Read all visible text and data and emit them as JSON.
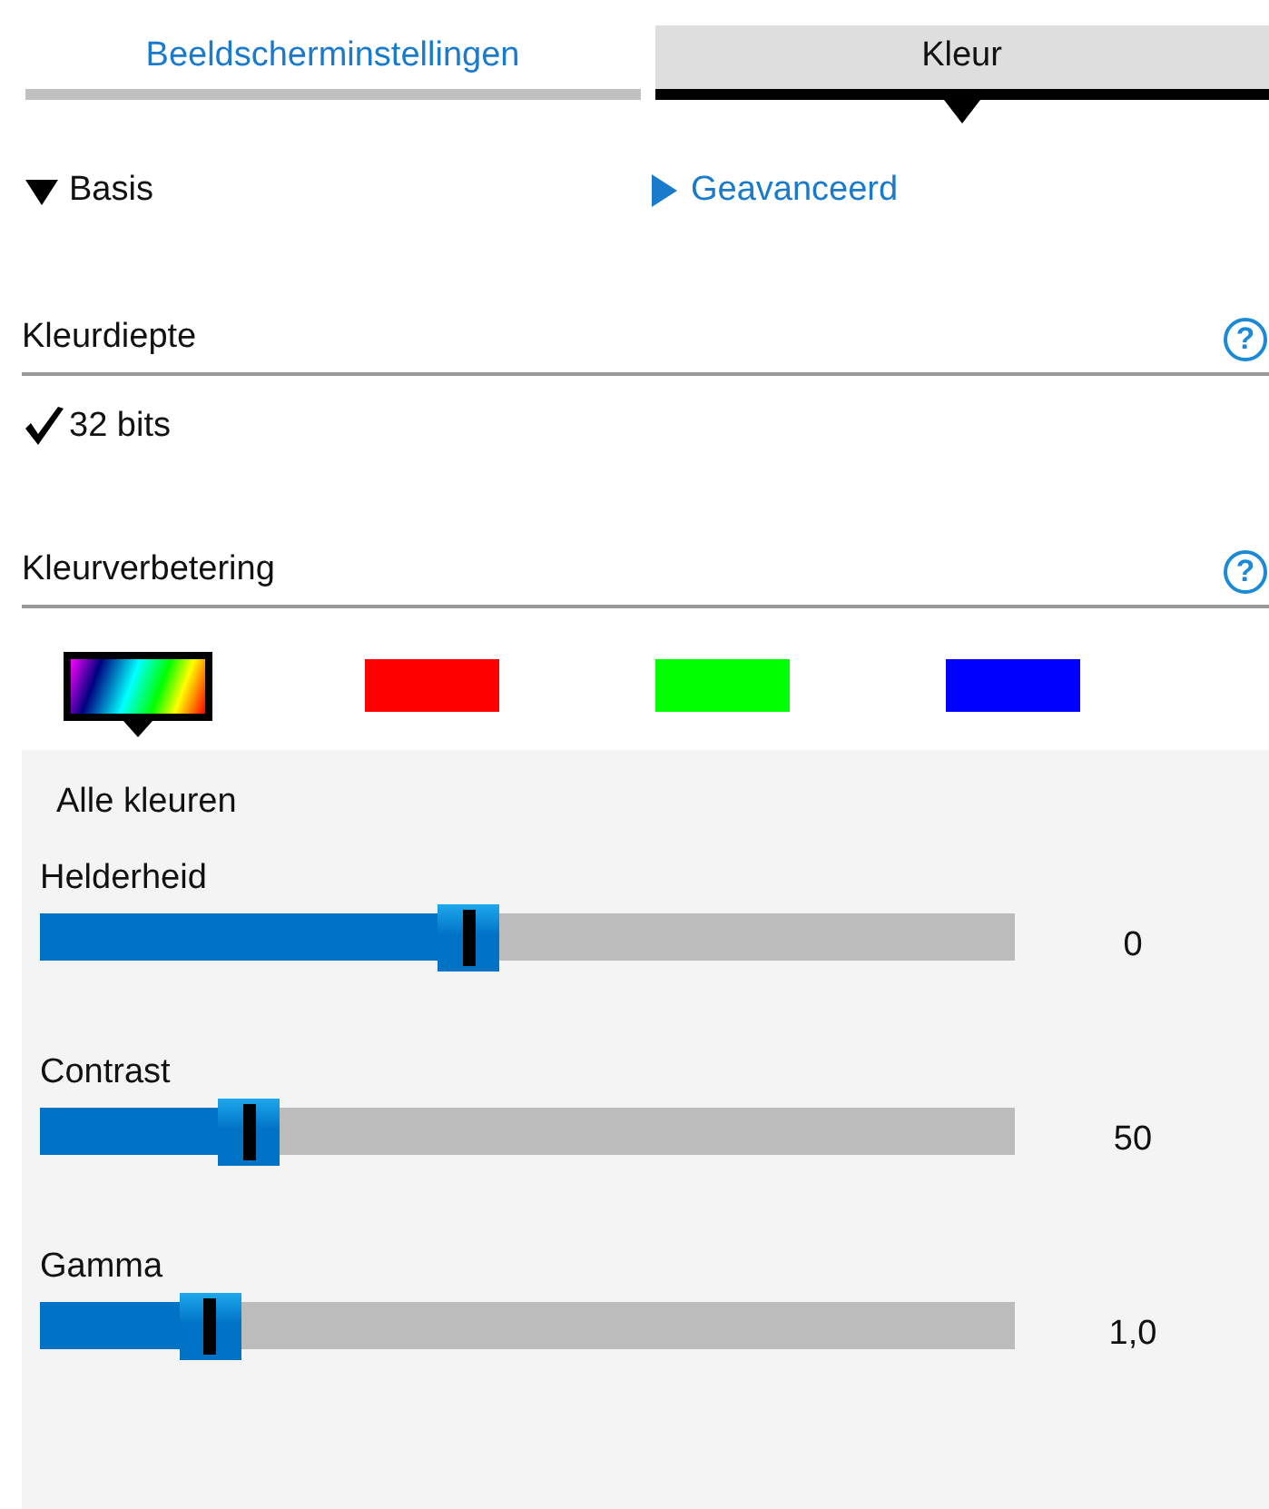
{
  "tabs": [
    {
      "label": "Beeldscherminstellingen",
      "selected": false
    },
    {
      "label": "Kleur",
      "selected": true
    }
  ],
  "modes": [
    {
      "label": "Basis",
      "expanded": true
    },
    {
      "label": "Geavanceerd",
      "expanded": false
    }
  ],
  "color_depth": {
    "heading": "Kleurdiepte",
    "help": "?",
    "option": "32 bits",
    "checked": true
  },
  "enhancement": {
    "heading": "Kleurverbetering",
    "help": "?",
    "swatches": [
      {
        "kind": "spectrum",
        "selected": true
      },
      {
        "kind": "solid",
        "color": "#ff0000",
        "selected": false
      },
      {
        "kind": "solid",
        "color": "#00ff00",
        "selected": false
      },
      {
        "kind": "solid",
        "color": "#0000ff",
        "selected": false
      }
    ],
    "panel_title": "Alle kleuren",
    "sliders": [
      {
        "label": "Helderheid",
        "level": 0.44,
        "reading": "0"
      },
      {
        "label": "Contrast",
        "level": 0.215,
        "reading": "50"
      },
      {
        "label": "Gamma",
        "level": 0.175,
        "reading": "1,0"
      }
    ]
  }
}
